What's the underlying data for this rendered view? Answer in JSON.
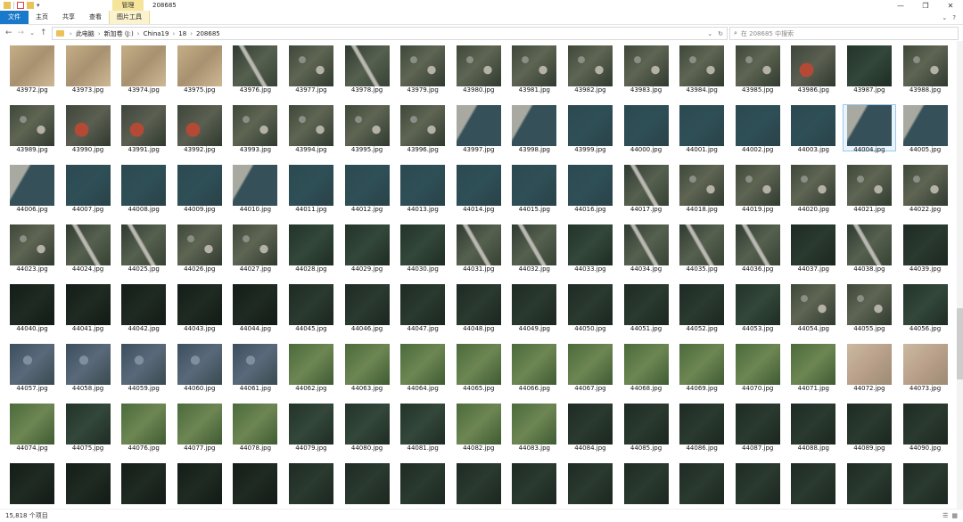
{
  "window": {
    "context_tab_label": "管理",
    "title": "208685"
  },
  "ribbon": {
    "tabs": [
      {
        "label": "文件"
      },
      {
        "label": "主页"
      },
      {
        "label": "共享"
      },
      {
        "label": "查看"
      },
      {
        "label": "图片工具"
      }
    ]
  },
  "address": {
    "breadcrumbs": [
      "此电脑",
      "新加卷 (J:)",
      "China19",
      "18",
      "208685"
    ]
  },
  "search": {
    "placeholder": "在 208685 中搜索"
  },
  "files": [
    {
      "name": "43972.jpg",
      "thumb": "sand"
    },
    {
      "name": "43973.jpg",
      "thumb": "sand"
    },
    {
      "name": "43974.jpg",
      "thumb": "sand"
    },
    {
      "name": "43975.jpg",
      "thumb": "sand"
    },
    {
      "name": "43976.jpg",
      "thumb": "road"
    },
    {
      "name": "43977.jpg",
      "thumb": "city"
    },
    {
      "name": "43978.jpg",
      "thumb": "road"
    },
    {
      "name": "43979.jpg",
      "thumb": "city"
    },
    {
      "name": "43980.jpg",
      "thumb": "city"
    },
    {
      "name": "43981.jpg",
      "thumb": "city"
    },
    {
      "name": "43982.jpg",
      "thumb": "city"
    },
    {
      "name": "43983.jpg",
      "thumb": "city"
    },
    {
      "name": "43984.jpg",
      "thumb": "city"
    },
    {
      "name": "43985.jpg",
      "thumb": "city"
    },
    {
      "name": "43986.jpg",
      "thumb": "red"
    },
    {
      "name": "43987.jpg",
      "thumb": "forest2"
    },
    {
      "name": "43988.jpg",
      "thumb": "city"
    },
    {
      "name": "43989.jpg",
      "thumb": "city"
    },
    {
      "name": "43990.jpg",
      "thumb": "red"
    },
    {
      "name": "43991.jpg",
      "thumb": "red"
    },
    {
      "name": "43992.jpg",
      "thumb": "red"
    },
    {
      "name": "43993.jpg",
      "thumb": "city"
    },
    {
      "name": "43994.jpg",
      "thumb": "city"
    },
    {
      "name": "43995.jpg",
      "thumb": "city"
    },
    {
      "name": "43996.jpg",
      "thumb": "city"
    },
    {
      "name": "43997.jpg",
      "thumb": "shore"
    },
    {
      "name": "43998.jpg",
      "thumb": "shore"
    },
    {
      "name": "43999.jpg",
      "thumb": "water"
    },
    {
      "name": "44000.jpg",
      "thumb": "water"
    },
    {
      "name": "44001.jpg",
      "thumb": "water"
    },
    {
      "name": "44002.jpg",
      "thumb": "water"
    },
    {
      "name": "44003.jpg",
      "thumb": "water"
    },
    {
      "name": "44004.jpg",
      "thumb": "shore",
      "selected": true
    },
    {
      "name": "44005.jpg",
      "thumb": "shore"
    },
    {
      "name": "44006.jpg",
      "thumb": "shore"
    },
    {
      "name": "44007.jpg",
      "thumb": "water"
    },
    {
      "name": "44008.jpg",
      "thumb": "water"
    },
    {
      "name": "44009.jpg",
      "thumb": "water"
    },
    {
      "name": "44010.jpg",
      "thumb": "shore"
    },
    {
      "name": "44011.jpg",
      "thumb": "water"
    },
    {
      "name": "44012.jpg",
      "thumb": "water"
    },
    {
      "name": "44013.jpg",
      "thumb": "water"
    },
    {
      "name": "44014.jpg",
      "thumb": "water"
    },
    {
      "name": "44015.jpg",
      "thumb": "water"
    },
    {
      "name": "44016.jpg",
      "thumb": "water"
    },
    {
      "name": "44017.jpg",
      "thumb": "road"
    },
    {
      "name": "44018.jpg",
      "thumb": "city"
    },
    {
      "name": "44019.jpg",
      "thumb": "city"
    },
    {
      "name": "44020.jpg",
      "thumb": "city"
    },
    {
      "name": "44021.jpg",
      "thumb": "city"
    },
    {
      "name": "44022.jpg",
      "thumb": "city"
    },
    {
      "name": "44023.jpg",
      "thumb": "city"
    },
    {
      "name": "44024.jpg",
      "thumb": "road"
    },
    {
      "name": "44025.jpg",
      "thumb": "road"
    },
    {
      "name": "44026.jpg",
      "thumb": "city"
    },
    {
      "name": "44027.jpg",
      "thumb": "city"
    },
    {
      "name": "44028.jpg",
      "thumb": "forest2"
    },
    {
      "name": "44029.jpg",
      "thumb": "forest2"
    },
    {
      "name": "44030.jpg",
      "thumb": "forest2"
    },
    {
      "name": "44031.jpg",
      "thumb": "road"
    },
    {
      "name": "44032.jpg",
      "thumb": "road"
    },
    {
      "name": "44033.jpg",
      "thumb": "forest2"
    },
    {
      "name": "44034.jpg",
      "thumb": "road"
    },
    {
      "name": "44035.jpg",
      "thumb": "road"
    },
    {
      "name": "44036.jpg",
      "thumb": "road"
    },
    {
      "name": "44037.jpg",
      "thumb": "forest"
    },
    {
      "name": "44038.jpg",
      "thumb": "road"
    },
    {
      "name": "44039.jpg",
      "thumb": "forest"
    },
    {
      "name": "44040.jpg",
      "thumb": "dark"
    },
    {
      "name": "44041.jpg",
      "thumb": "dark"
    },
    {
      "name": "44042.jpg",
      "thumb": "dark"
    },
    {
      "name": "44043.jpg",
      "thumb": "dark"
    },
    {
      "name": "44044.jpg",
      "thumb": "dark"
    },
    {
      "name": "44045.jpg",
      "thumb": "forest"
    },
    {
      "name": "44046.jpg",
      "thumb": "forest"
    },
    {
      "name": "44047.jpg",
      "thumb": "forest"
    },
    {
      "name": "44048.jpg",
      "thumb": "forest"
    },
    {
      "name": "44049.jpg",
      "thumb": "forest"
    },
    {
      "name": "44050.jpg",
      "thumb": "forest"
    },
    {
      "name": "44051.jpg",
      "thumb": "forest"
    },
    {
      "name": "44052.jpg",
      "thumb": "forest"
    },
    {
      "name": "44053.jpg",
      "thumb": "forest2"
    },
    {
      "name": "44054.jpg",
      "thumb": "city"
    },
    {
      "name": "44055.jpg",
      "thumb": "city"
    },
    {
      "name": "44056.jpg",
      "thumb": "forest2"
    },
    {
      "name": "44057.jpg",
      "thumb": "village"
    },
    {
      "name": "44058.jpg",
      "thumb": "village"
    },
    {
      "name": "44059.jpg",
      "thumb": "village"
    },
    {
      "name": "44060.jpg",
      "thumb": "village"
    },
    {
      "name": "44061.jpg",
      "thumb": "village"
    },
    {
      "name": "44062.jpg",
      "thumb": "field"
    },
    {
      "name": "44063.jpg",
      "thumb": "field"
    },
    {
      "name": "44064.jpg",
      "thumb": "field"
    },
    {
      "name": "44065.jpg",
      "thumb": "field"
    },
    {
      "name": "44066.jpg",
      "thumb": "field"
    },
    {
      "name": "44067.jpg",
      "thumb": "field"
    },
    {
      "name": "44068.jpg",
      "thumb": "field"
    },
    {
      "name": "44069.jpg",
      "thumb": "field"
    },
    {
      "name": "44070.jpg",
      "thumb": "field"
    },
    {
      "name": "44071.jpg",
      "thumb": "field"
    },
    {
      "name": "44072.jpg",
      "thumb": "bare"
    },
    {
      "name": "44073.jpg",
      "thumb": "bare"
    },
    {
      "name": "44074.jpg",
      "thumb": "field"
    },
    {
      "name": "44075.jpg",
      "thumb": "forest2"
    },
    {
      "name": "44076.jpg",
      "thumb": "field"
    },
    {
      "name": "44077.jpg",
      "thumb": "field"
    },
    {
      "name": "44078.jpg",
      "thumb": "field"
    },
    {
      "name": "44079.jpg",
      "thumb": "forest2"
    },
    {
      "name": "44080.jpg",
      "thumb": "forest2"
    },
    {
      "name": "44081.jpg",
      "thumb": "forest2"
    },
    {
      "name": "44082.jpg",
      "thumb": "field"
    },
    {
      "name": "44083.jpg",
      "thumb": "field"
    },
    {
      "name": "44084.jpg",
      "thumb": "forest"
    },
    {
      "name": "44085.jpg",
      "thumb": "forest"
    },
    {
      "name": "44086.jpg",
      "thumb": "forest"
    },
    {
      "name": "44087.jpg",
      "thumb": "forest"
    },
    {
      "name": "44088.jpg",
      "thumb": "forest"
    },
    {
      "name": "44089.jpg",
      "thumb": "forest"
    },
    {
      "name": "44090.jpg",
      "thumb": "forest"
    },
    {
      "name": "",
      "thumb": "dark"
    },
    {
      "name": "",
      "thumb": "dark"
    },
    {
      "name": "",
      "thumb": "dark"
    },
    {
      "name": "",
      "thumb": "dark"
    },
    {
      "name": "",
      "thumb": "dark"
    },
    {
      "name": "",
      "thumb": "forest"
    },
    {
      "name": "",
      "thumb": "forest"
    },
    {
      "name": "",
      "thumb": "forest"
    },
    {
      "name": "",
      "thumb": "forest"
    },
    {
      "name": "",
      "thumb": "forest"
    },
    {
      "name": "",
      "thumb": "forest"
    },
    {
      "name": "",
      "thumb": "forest"
    },
    {
      "name": "",
      "thumb": "forest"
    },
    {
      "name": "",
      "thumb": "forest"
    },
    {
      "name": "",
      "thumb": "forest"
    },
    {
      "name": "",
      "thumb": "forest"
    },
    {
      "name": "",
      "thumb": "forest"
    }
  ],
  "status": {
    "item_count": "15,818 个项目"
  }
}
